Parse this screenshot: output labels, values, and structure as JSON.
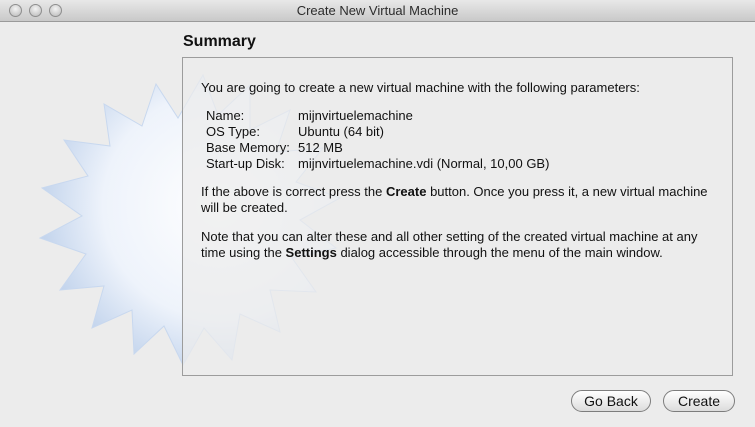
{
  "window": {
    "title": "Create New Virtual Machine"
  },
  "summary": {
    "heading": "Summary",
    "intro": "You are going to create a new virtual machine with the following parameters:",
    "params": [
      {
        "key": "Name:",
        "value": "mijnvirtuelemachine"
      },
      {
        "key": "OS Type:",
        "value": "Ubuntu (64 bit)"
      },
      {
        "key": "Base Memory:",
        "value": "512 MB"
      },
      {
        "key": "Start-up Disk:",
        "value": "mijnvirtuelemachine.vdi (Normal, 10,00 GB)"
      }
    ],
    "para2_pre": "If the above is correct press the ",
    "para2_bold": "Create",
    "para2_post": " button. Once you press it, a new virtual machine will be created.",
    "para3_pre": "Note that you can alter these and all other setting of the created virtual machine at any time using the ",
    "para3_bold": "Settings",
    "para3_post": " dialog accessible through the menu of the main window."
  },
  "buttons": {
    "back": "Go Back",
    "create": "Create"
  },
  "icons": {
    "close": "close-button-icon",
    "minimize": "minimize-button-icon",
    "zoom": "zoom-button-icon",
    "decoration": "starburst-icon"
  }
}
